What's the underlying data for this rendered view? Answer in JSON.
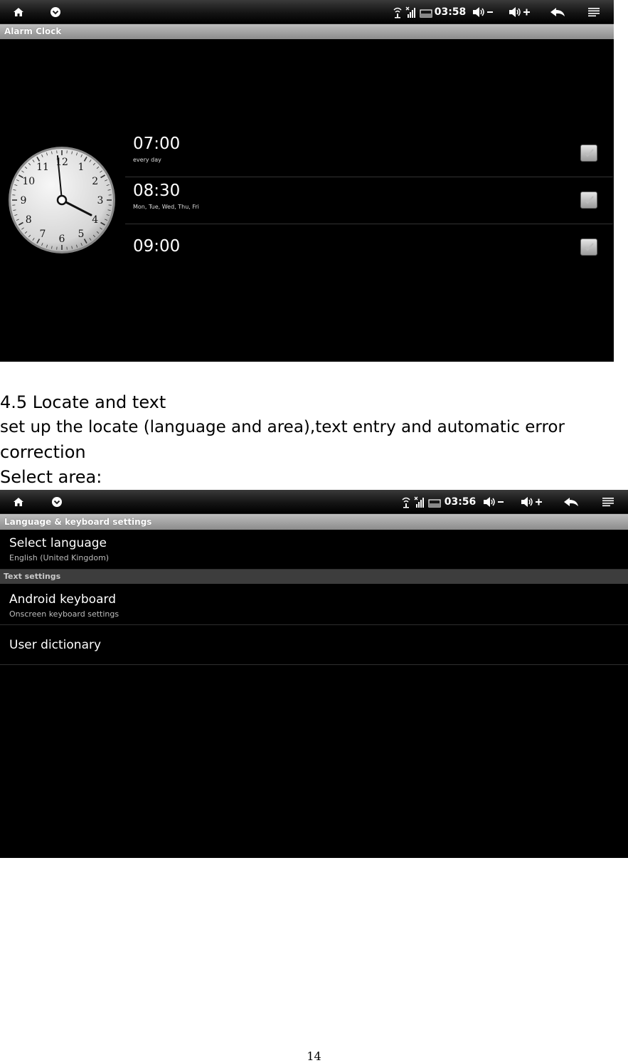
{
  "screenshot1": {
    "status": {
      "time": "03:58"
    },
    "title": "Alarm Clock",
    "clock": {
      "hours": [
        "12",
        "1",
        "2",
        "3",
        "4",
        "5",
        "6",
        "7",
        "8",
        "9",
        "10",
        "11"
      ],
      "time_shown": "03:58"
    },
    "alarms": [
      {
        "time": "07:00",
        "days": "every day",
        "enabled": true
      },
      {
        "time": "08:30",
        "days": "Mon, Tue, Wed, Thu, Fri",
        "enabled": true
      },
      {
        "time": "09:00",
        "days": "",
        "enabled": true
      }
    ]
  },
  "doc": {
    "heading": "4.5 Locate and text",
    "line1": "set up the locate (language and area),text entry and automatic error",
    "line2": "correction",
    "line3": "Select area:"
  },
  "screenshot2": {
    "status": {
      "time": "03:56"
    },
    "title": "Language & keyboard settings",
    "select_language": {
      "title": "Select language",
      "subtitle": "English (United Kingdom)"
    },
    "section": "Text settings",
    "android_keyboard": {
      "title": "Android keyboard",
      "subtitle": "Onscreen keyboard settings"
    },
    "user_dictionary": {
      "title": "User dictionary"
    }
  },
  "page_number": "14"
}
